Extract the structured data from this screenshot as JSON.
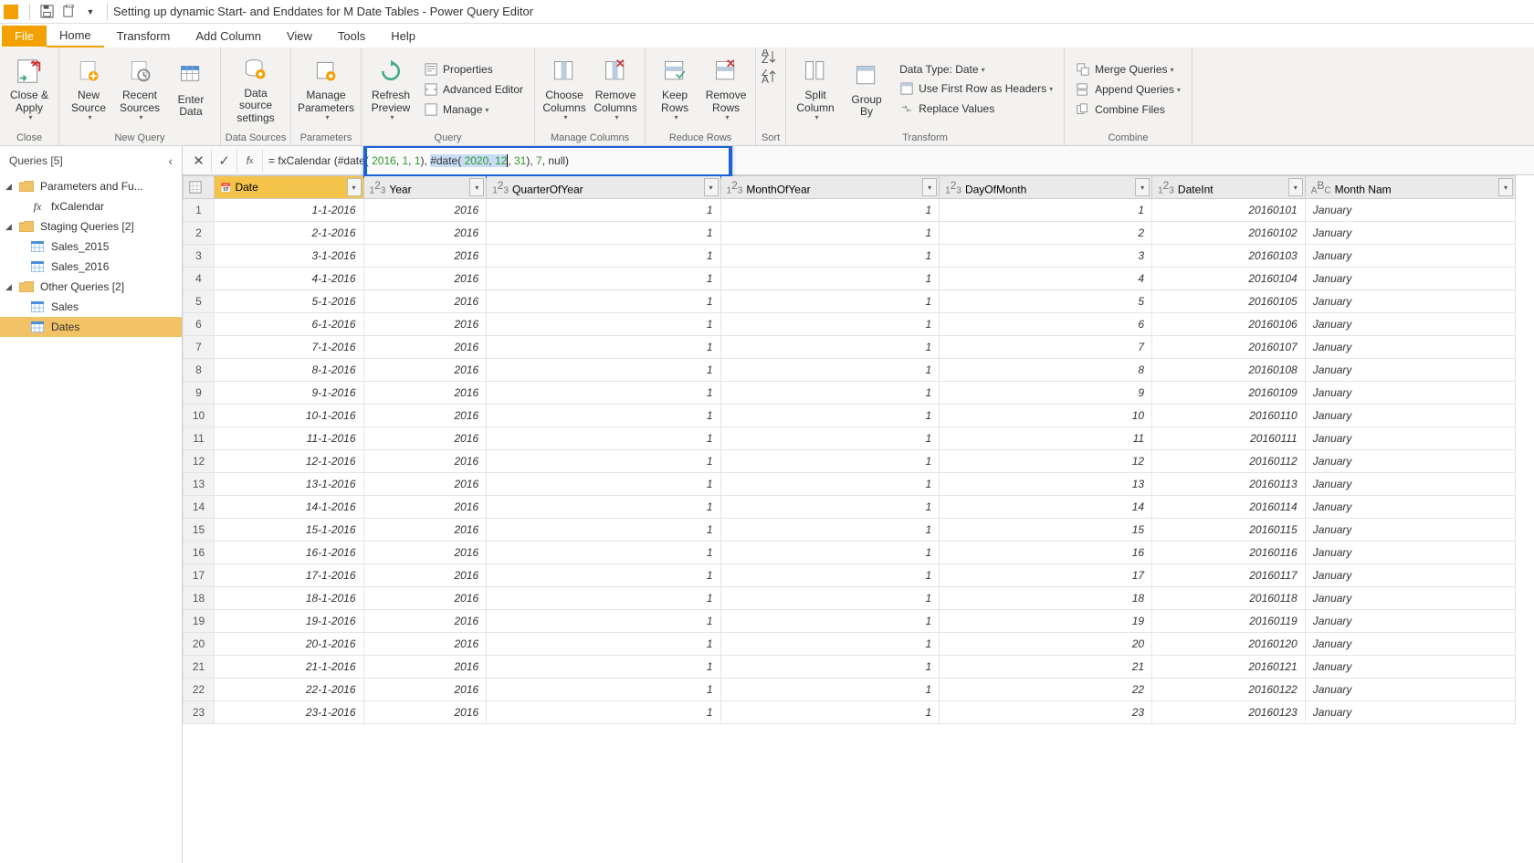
{
  "window": {
    "title": "Setting up dynamic Start- and Enddates for M Date Tables - Power Query Editor"
  },
  "tabs": {
    "file": "File",
    "home": "Home",
    "transform": "Transform",
    "addcolumn": "Add Column",
    "view": "View",
    "tools": "Tools",
    "help": "Help"
  },
  "ribbon": {
    "closeapply": "Close & Apply",
    "close_group": "Close",
    "newsource": "New Source",
    "recentsources": "Recent Sources",
    "enterdata": "Enter Data",
    "newquery_group": "New Query",
    "datasourcesettings": "Data source settings",
    "datasources_group": "Data Sources",
    "manageparameters": "Manage Parameters",
    "parameters_group": "Parameters",
    "refreshpreview": "Refresh Preview",
    "properties": "Properties",
    "advancededitor": "Advanced Editor",
    "manage": "Manage",
    "query_group": "Query",
    "choosecolumns": "Choose Columns",
    "removecolumns": "Remove Columns",
    "managecolumns_group": "Manage Columns",
    "keeprows": "Keep Rows",
    "removerows": "Remove Rows",
    "reducerows_group": "Reduce Rows",
    "sort_group": "Sort",
    "splitcolumn": "Split Column",
    "groupby": "Group By",
    "datatype": "Data Type: Date",
    "usefirstrow": "Use First Row as Headers",
    "replacevalues": "Replace Values",
    "transform_group": "Transform",
    "mergequeries": "Merge Queries",
    "appendqueries": "Append Queries",
    "combinefiles": "Combine Files",
    "combine_group": "Combine"
  },
  "queries": {
    "header": "Queries [5]",
    "groups": [
      {
        "label": "Parameters and Fu...",
        "items": [
          {
            "label": "fxCalendar",
            "type": "fx"
          }
        ]
      },
      {
        "label": "Staging Queries [2]",
        "items": [
          {
            "label": "Sales_2015",
            "type": "table"
          },
          {
            "label": "Sales_2016",
            "type": "table"
          }
        ]
      },
      {
        "label": "Other Queries [2]",
        "items": [
          {
            "label": "Sales",
            "type": "table"
          },
          {
            "label": "Dates",
            "type": "table",
            "selected": true
          }
        ]
      }
    ]
  },
  "formula": {
    "prefix": "= fxCalendar ",
    "open": "(",
    "d1": "#date",
    "d1_open": "( ",
    "d1_y": "2016",
    "d1_sep1": ", ",
    "d1_m": "1",
    "d1_sep2": ", ",
    "d1_d": "1",
    "d1_close": "), ",
    "d2": "#date",
    "d2_open": "( ",
    "d2_y": "2020",
    "d2_sep1": ", ",
    "d2_m": "12",
    "d2_sep2": ", ",
    "d2_d": "31",
    "d2_close": "), ",
    "arg3": "7",
    "sep3": ", ",
    "arg4": "null",
    "close": ")"
  },
  "columns": [
    {
      "name": "Date",
      "type": "date"
    },
    {
      "name": "Year",
      "type": "123"
    },
    {
      "name": "QuarterOfYear",
      "type": "123"
    },
    {
      "name": "MonthOfYear",
      "type": "123"
    },
    {
      "name": "DayOfMonth",
      "type": "123"
    },
    {
      "name": "DateInt",
      "type": "123"
    },
    {
      "name": "Month Nam",
      "type": "abc"
    }
  ],
  "rows": [
    {
      "n": 1,
      "date": "1-1-2016",
      "year": "2016",
      "q": "1",
      "m": "1",
      "d": "1",
      "di": "20160101",
      "mn": "January"
    },
    {
      "n": 2,
      "date": "2-1-2016",
      "year": "2016",
      "q": "1",
      "m": "1",
      "d": "2",
      "di": "20160102",
      "mn": "January"
    },
    {
      "n": 3,
      "date": "3-1-2016",
      "year": "2016",
      "q": "1",
      "m": "1",
      "d": "3",
      "di": "20160103",
      "mn": "January"
    },
    {
      "n": 4,
      "date": "4-1-2016",
      "year": "2016",
      "q": "1",
      "m": "1",
      "d": "4",
      "di": "20160104",
      "mn": "January"
    },
    {
      "n": 5,
      "date": "5-1-2016",
      "year": "2016",
      "q": "1",
      "m": "1",
      "d": "5",
      "di": "20160105",
      "mn": "January"
    },
    {
      "n": 6,
      "date": "6-1-2016",
      "year": "2016",
      "q": "1",
      "m": "1",
      "d": "6",
      "di": "20160106",
      "mn": "January"
    },
    {
      "n": 7,
      "date": "7-1-2016",
      "year": "2016",
      "q": "1",
      "m": "1",
      "d": "7",
      "di": "20160107",
      "mn": "January"
    },
    {
      "n": 8,
      "date": "8-1-2016",
      "year": "2016",
      "q": "1",
      "m": "1",
      "d": "8",
      "di": "20160108",
      "mn": "January"
    },
    {
      "n": 9,
      "date": "9-1-2016",
      "year": "2016",
      "q": "1",
      "m": "1",
      "d": "9",
      "di": "20160109",
      "mn": "January"
    },
    {
      "n": 10,
      "date": "10-1-2016",
      "year": "2016",
      "q": "1",
      "m": "1",
      "d": "10",
      "di": "20160110",
      "mn": "January"
    },
    {
      "n": 11,
      "date": "11-1-2016",
      "year": "2016",
      "q": "1",
      "m": "1",
      "d": "11",
      "di": "20160111",
      "mn": "January"
    },
    {
      "n": 12,
      "date": "12-1-2016",
      "year": "2016",
      "q": "1",
      "m": "1",
      "d": "12",
      "di": "20160112",
      "mn": "January"
    },
    {
      "n": 13,
      "date": "13-1-2016",
      "year": "2016",
      "q": "1",
      "m": "1",
      "d": "13",
      "di": "20160113",
      "mn": "January"
    },
    {
      "n": 14,
      "date": "14-1-2016",
      "year": "2016",
      "q": "1",
      "m": "1",
      "d": "14",
      "di": "20160114",
      "mn": "January"
    },
    {
      "n": 15,
      "date": "15-1-2016",
      "year": "2016",
      "q": "1",
      "m": "1",
      "d": "15",
      "di": "20160115",
      "mn": "January"
    },
    {
      "n": 16,
      "date": "16-1-2016",
      "year": "2016",
      "q": "1",
      "m": "1",
      "d": "16",
      "di": "20160116",
      "mn": "January"
    },
    {
      "n": 17,
      "date": "17-1-2016",
      "year": "2016",
      "q": "1",
      "m": "1",
      "d": "17",
      "di": "20160117",
      "mn": "January"
    },
    {
      "n": 18,
      "date": "18-1-2016",
      "year": "2016",
      "q": "1",
      "m": "1",
      "d": "18",
      "di": "20160118",
      "mn": "January"
    },
    {
      "n": 19,
      "date": "19-1-2016",
      "year": "2016",
      "q": "1",
      "m": "1",
      "d": "19",
      "di": "20160119",
      "mn": "January"
    },
    {
      "n": 20,
      "date": "20-1-2016",
      "year": "2016",
      "q": "1",
      "m": "1",
      "d": "20",
      "di": "20160120",
      "mn": "January"
    },
    {
      "n": 21,
      "date": "21-1-2016",
      "year": "2016",
      "q": "1",
      "m": "1",
      "d": "21",
      "di": "20160121",
      "mn": "January"
    },
    {
      "n": 22,
      "date": "22-1-2016",
      "year": "2016",
      "q": "1",
      "m": "1",
      "d": "22",
      "di": "20160122",
      "mn": "January"
    },
    {
      "n": 23,
      "date": "23-1-2016",
      "year": "2016",
      "q": "1",
      "m": "1",
      "d": "23",
      "di": "20160123",
      "mn": "January"
    }
  ]
}
